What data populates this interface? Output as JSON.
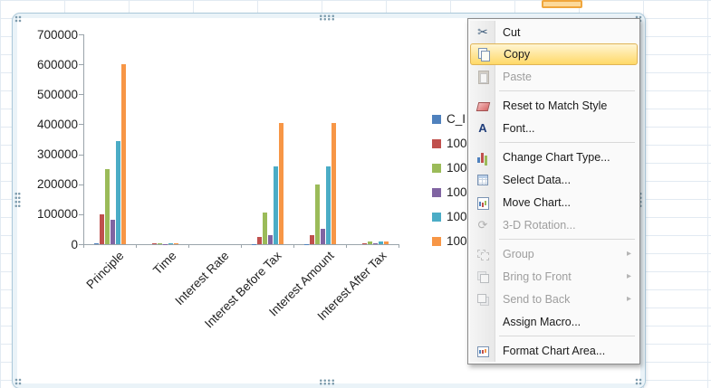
{
  "chart_data": {
    "type": "bar",
    "title": "",
    "xlabel": "",
    "ylabel": "",
    "categories": [
      "Principle",
      "Time",
      "Interest Rate",
      "Interest Before Tax",
      "Interest Amount",
      "Interest After Tax"
    ],
    "series": [
      {
        "name": "C_I",
        "color": "#4F81BD",
        "values": [
          2000,
          30,
          7,
          1500,
          1500,
          400
        ]
      },
      {
        "name": "100",
        "color": "#C0504D",
        "values": [
          100000,
          2000,
          50,
          25000,
          30000,
          2000
        ]
      },
      {
        "name": "100",
        "color": "#9BBB59",
        "values": [
          250000,
          2500,
          60,
          105000,
          200000,
          8000
        ]
      },
      {
        "name": "100",
        "color": "#8064A2",
        "values": [
          80000,
          1500,
          40,
          30000,
          50000,
          2500
        ]
      },
      {
        "name": "100",
        "color": "#4BACC6",
        "values": [
          345000,
          3000,
          80,
          260000,
          260000,
          9000
        ]
      },
      {
        "name": "100",
        "color": "#F79646",
        "values": [
          600000,
          4000,
          100,
          405000,
          405000,
          10000
        ]
      }
    ],
    "ylim": [
      0,
      700000
    ],
    "yticks": [
      0,
      100000,
      200000,
      300000,
      400000,
      500000,
      600000,
      700000
    ],
    "grid": false,
    "legend_position": "right"
  },
  "context_menu": {
    "items": [
      {
        "label": "Cut",
        "icon": "scissors-icon",
        "enabled": true
      },
      {
        "label": "Copy",
        "icon": "copy-icon",
        "enabled": true,
        "highlighted": true
      },
      {
        "label": "Paste",
        "icon": "paste-icon",
        "enabled": false,
        "separator_after": true
      },
      {
        "label": "Reset to Match Style",
        "icon": "reset-style-icon",
        "enabled": true
      },
      {
        "label": "Font...",
        "icon": "font-icon",
        "enabled": true,
        "separator_after": true
      },
      {
        "label": "Change Chart Type...",
        "icon": "chart-type-icon",
        "enabled": true
      },
      {
        "label": "Select Data...",
        "icon": "select-data-icon",
        "enabled": true
      },
      {
        "label": "Move Chart...",
        "icon": "move-chart-icon",
        "enabled": true
      },
      {
        "label": "3-D Rotation...",
        "icon": "rotation-3d-icon",
        "enabled": false,
        "separator_after": true
      },
      {
        "label": "Group",
        "icon": "group-icon",
        "enabled": false,
        "submenu": true
      },
      {
        "label": "Bring to Front",
        "icon": "bring-front-icon",
        "enabled": false,
        "submenu": true
      },
      {
        "label": "Send to Back",
        "icon": "send-back-icon",
        "enabled": false,
        "submenu": true
      },
      {
        "label": "Assign Macro...",
        "icon": "macro-icon",
        "enabled": true,
        "separator_after": true
      },
      {
        "label": "Format Chart Area...",
        "icon": "format-chart-area-icon",
        "enabled": true
      }
    ],
    "submenu_arrow": "▸"
  },
  "colors": {
    "selection_frame": "#aecadb",
    "menu_highlight_top": "#fff5d3",
    "menu_highlight_bottom": "#ffd968",
    "axis": "#9aa4ab"
  }
}
